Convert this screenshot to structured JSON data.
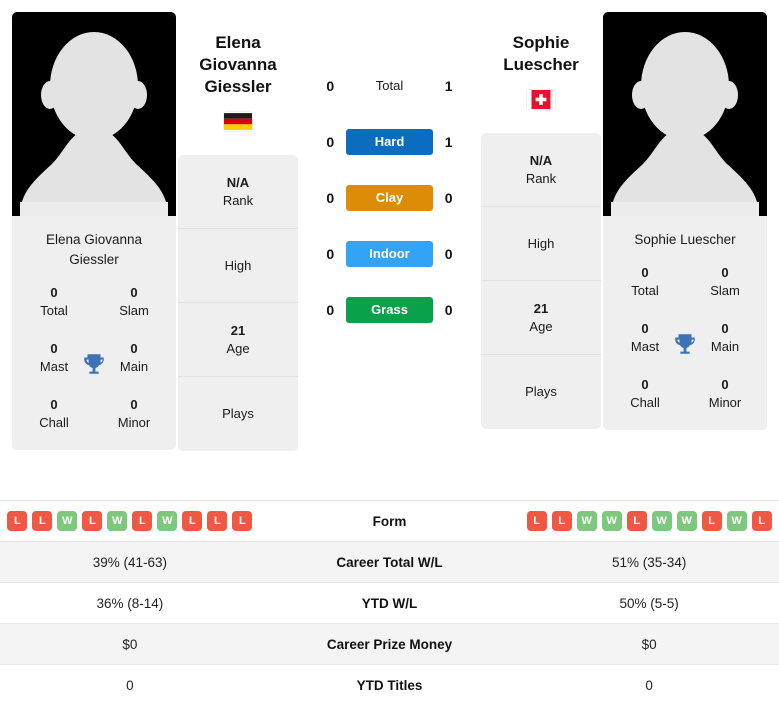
{
  "players": {
    "left": {
      "name": "Elena Giovanna Giessler",
      "name_line1": "Elena Giovanna",
      "name_line2": "Giessler",
      "country": "Germany",
      "flag_icon": "flag-germany-icon",
      "avatar_icon": "player-avatar-placeholder-icon",
      "info": [
        {
          "value": "N/A",
          "label": "Rank"
        },
        {
          "value": "",
          "label": "High"
        },
        {
          "value": "21",
          "label": "Age"
        },
        {
          "value": "",
          "label": "Plays"
        }
      ],
      "titles": [
        {
          "value": "0",
          "label": "Total"
        },
        {
          "value": "0",
          "label": "Slam"
        },
        {
          "value": "0",
          "label": "Mast"
        },
        {
          "value": "0",
          "label": "Main"
        },
        {
          "value": "0",
          "label": "Chall"
        },
        {
          "value": "0",
          "label": "Minor"
        }
      ],
      "form": [
        "L",
        "L",
        "W",
        "L",
        "W",
        "L",
        "W",
        "L",
        "L",
        "L"
      ],
      "career_total_wl": "39% (41-63)",
      "ytd_wl": "36% (8-14)",
      "career_prize_money": "$0",
      "ytd_titles": "0"
    },
    "right": {
      "name": "Sophie Luescher",
      "name_line1": "Sophie",
      "name_line2": "Luescher",
      "country": "Switzerland",
      "flag_icon": "flag-switzerland-icon",
      "avatar_icon": "player-avatar-placeholder-icon",
      "info": [
        {
          "value": "N/A",
          "label": "Rank"
        },
        {
          "value": "",
          "label": "High"
        },
        {
          "value": "21",
          "label": "Age"
        },
        {
          "value": "",
          "label": "Plays"
        }
      ],
      "titles": [
        {
          "value": "0",
          "label": "Total"
        },
        {
          "value": "0",
          "label": "Slam"
        },
        {
          "value": "0",
          "label": "Mast"
        },
        {
          "value": "0",
          "label": "Main"
        },
        {
          "value": "0",
          "label": "Chall"
        },
        {
          "value": "0",
          "label": "Minor"
        }
      ],
      "form": [
        "L",
        "L",
        "W",
        "W",
        "L",
        "W",
        "W",
        "L",
        "W",
        "L"
      ],
      "career_total_wl": "51% (35-34)",
      "ytd_wl": "50% (5-5)",
      "career_prize_money": "$0",
      "ytd_titles": "0"
    }
  },
  "titles_trophy_icon": "trophy-icon",
  "head_to_head": [
    {
      "label": "Total",
      "left": "0",
      "right": "1",
      "color": ""
    },
    {
      "label": "Hard",
      "left": "0",
      "right": "1",
      "color": "#0b6cc0"
    },
    {
      "label": "Clay",
      "left": "0",
      "right": "0",
      "color": "#dd8c07"
    },
    {
      "label": "Indoor",
      "left": "0",
      "right": "0",
      "color": "#32a3f5"
    },
    {
      "label": "Grass",
      "left": "0",
      "right": "0",
      "color": "#09a24a"
    }
  ],
  "stats_rows": [
    {
      "label": "Form",
      "key": "form"
    },
    {
      "label": "Career Total W/L",
      "key": "career_total_wl"
    },
    {
      "label": "YTD W/L",
      "key": "ytd_wl"
    },
    {
      "label": "Career Prize Money",
      "key": "career_prize_money"
    },
    {
      "label": "YTD Titles",
      "key": "ytd_titles"
    }
  ],
  "colors": {
    "win_badge": "#7ec87e",
    "loss_badge": "#ef5843",
    "card_bg": "#efefef",
    "row_alt_bg": "#f4f4f4"
  }
}
